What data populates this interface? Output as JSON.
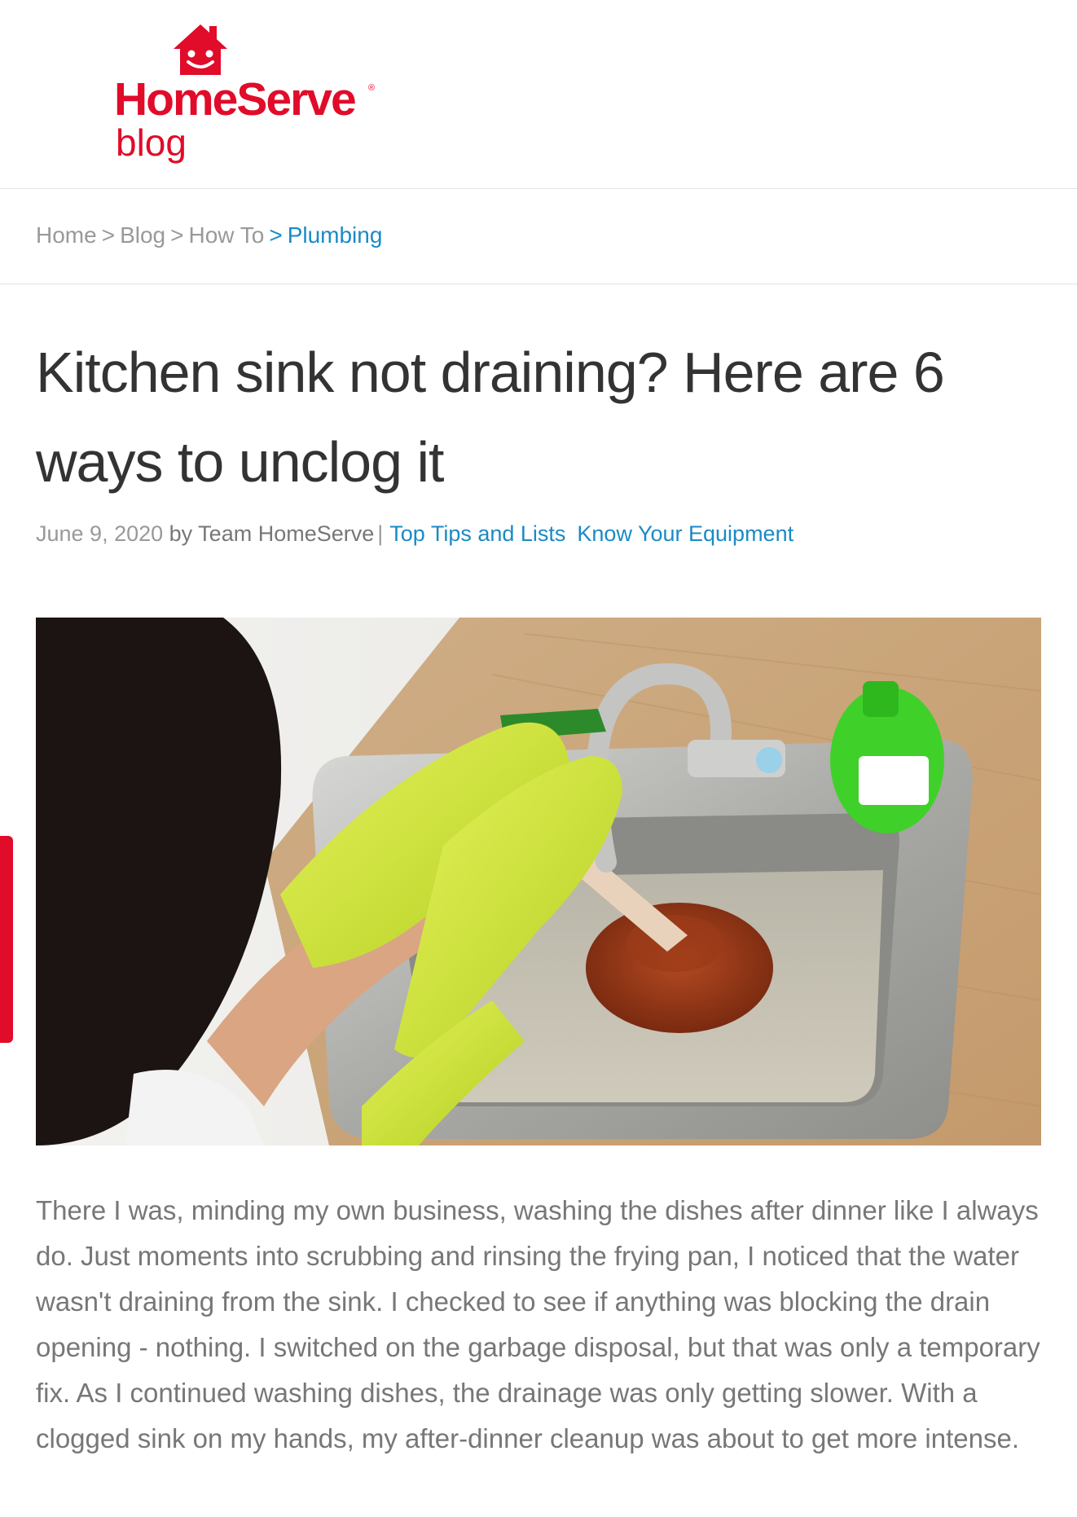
{
  "header": {
    "brand": "HomeServe",
    "registered_mark": "®",
    "sub": "blog",
    "brand_color": "#e10b2a"
  },
  "breadcrumb": {
    "items": [
      {
        "label": "Home"
      },
      {
        "label": "Blog"
      },
      {
        "label": "How To"
      },
      {
        "label": "Plumbing"
      }
    ],
    "separator": ">",
    "link_color": "#1a8ac6"
  },
  "article": {
    "title": "Kitchen sink not draining? Here are 6 ways to unclog it",
    "date": "June 9, 2020",
    "author": "by Team HomeServe",
    "separator": "|",
    "categories": [
      "Top Tips and Lists",
      "Know Your Equipment"
    ],
    "hero_icon": "kitchen-sink-plunger-photo",
    "body": "There I was, minding my own business, washing the dishes after dinner like I always do. Just moments into scrubbing and rinsing the frying pan, I noticed that the water wasn't draining from the sink. I checked to see if anything was blocking the drain opening - nothing. I switched on the garbage disposal, but that was only a temporary fix. As I continued washing dishes, the drainage was only getting slower. With a clogged sink on my hands, my after-dinner cleanup was about to get more intense."
  },
  "side_tab": {
    "color": "#e10b2a"
  }
}
